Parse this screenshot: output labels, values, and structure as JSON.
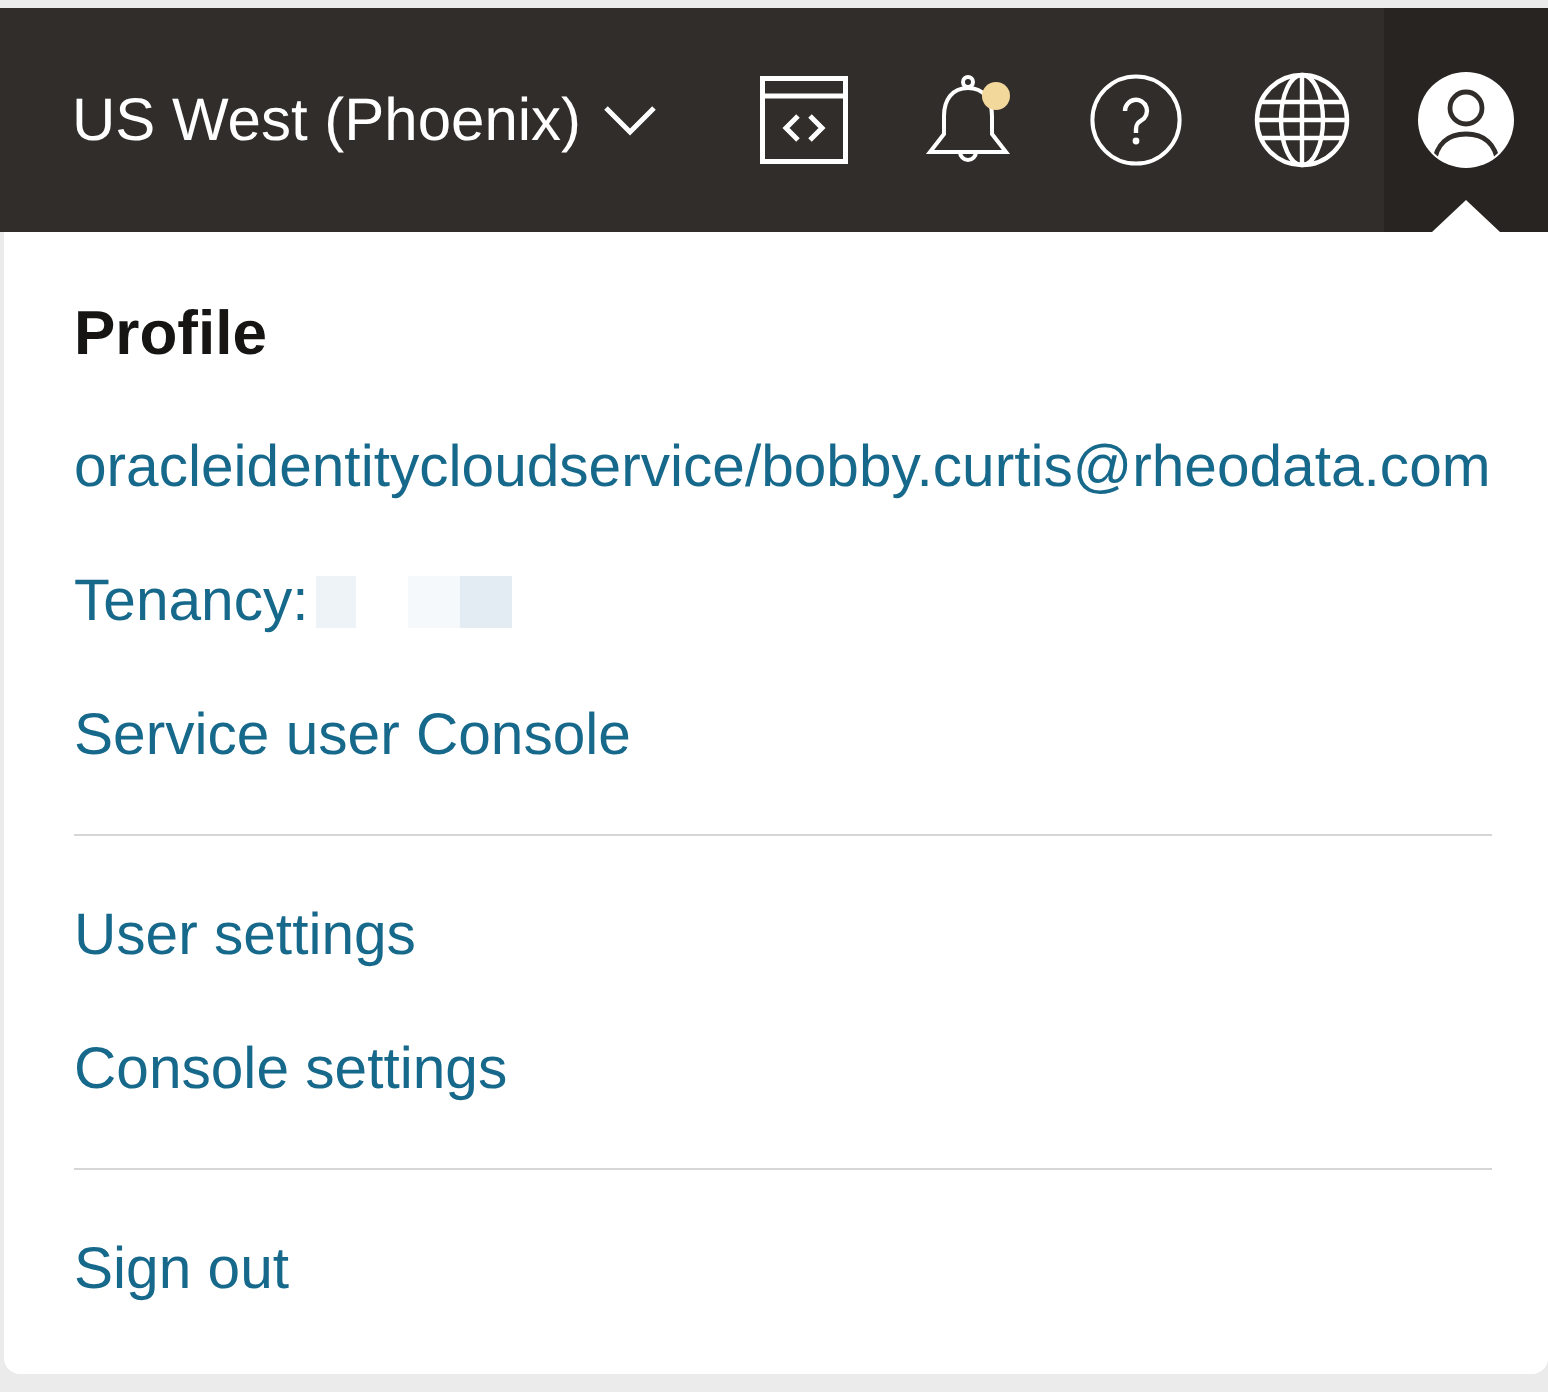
{
  "header": {
    "region": {
      "label": "US West (Phoenix)"
    },
    "toolbar": [
      {
        "kind": "code-editor"
      },
      {
        "kind": "notifications",
        "unread": true
      },
      {
        "kind": "help"
      },
      {
        "kind": "language"
      },
      {
        "kind": "profile",
        "menu_open": true
      }
    ]
  },
  "profile_menu": {
    "title": "Profile",
    "sections": [
      [
        {
          "kind": "link",
          "label": "oracleidentitycloudservice/bobby.curtis@rheodata.com"
        },
        {
          "kind": "field",
          "label": "Tenancy:",
          "redacted": true
        },
        {
          "kind": "link",
          "label": "Service user Console"
        }
      ],
      [
        {
          "kind": "link",
          "label": "User settings"
        },
        {
          "kind": "link",
          "label": "Console settings"
        }
      ],
      [
        {
          "kind": "link",
          "label": "Sign out"
        }
      ]
    ]
  }
}
